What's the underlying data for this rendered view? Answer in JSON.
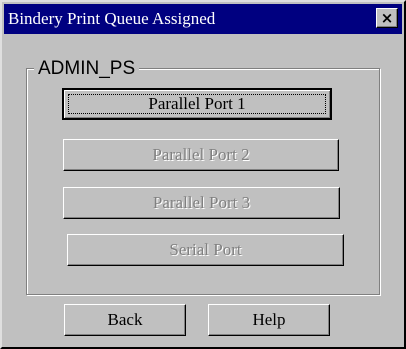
{
  "window": {
    "title": "Bindery Print Queue Assigned",
    "close_glyph": "×",
    "colors": {
      "titlebar": "#000080",
      "face": "#c0c0c0",
      "disabled_text": "#808080"
    }
  },
  "group": {
    "label": "ADMIN_PS"
  },
  "ports": [
    {
      "label": "Parallel Port 1",
      "enabled": true,
      "focused": true
    },
    {
      "label": "Parallel Port 2",
      "enabled": false
    },
    {
      "label": "Parallel Port 3",
      "enabled": false
    },
    {
      "label": "Serial Port",
      "enabled": false
    }
  ],
  "footer": {
    "back_label": "Back",
    "help_label": "Help"
  }
}
